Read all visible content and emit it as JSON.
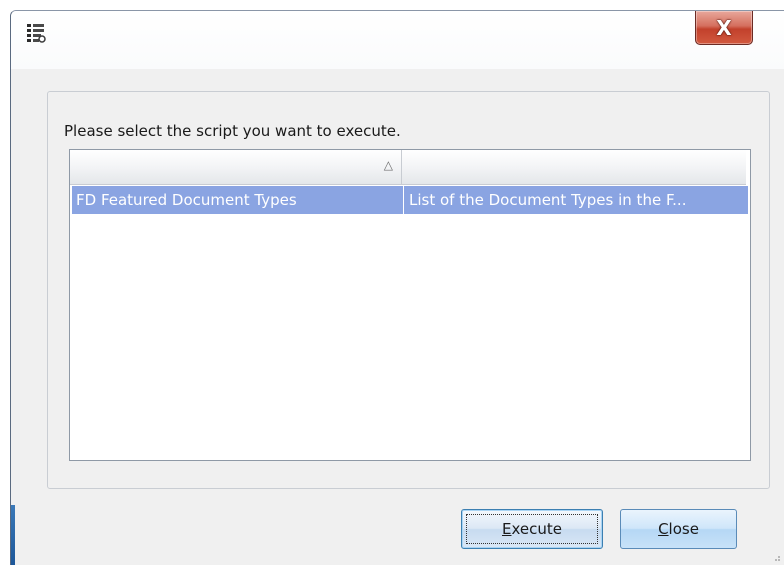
{
  "window": {
    "icon": "app-list-icon",
    "close_label": "X"
  },
  "group": {
    "instruction": "Please select the script you want to execute."
  },
  "list": {
    "columns": [
      {
        "label": "",
        "sort_indicator": "△"
      },
      {
        "label": ""
      }
    ],
    "rows": [
      {
        "name": "FD Featured Document Types",
        "description": "List of the Document Types in the F...",
        "selected": true
      }
    ]
  },
  "buttons": {
    "execute": {
      "mnemonic": "E",
      "rest": "xecute"
    },
    "close": {
      "mnemonic": "C",
      "rest": "lose"
    }
  },
  "colors": {
    "selection": "#8aa4e2",
    "close_button": "#c2412c",
    "dialog_bg": "#f0f0f0"
  }
}
